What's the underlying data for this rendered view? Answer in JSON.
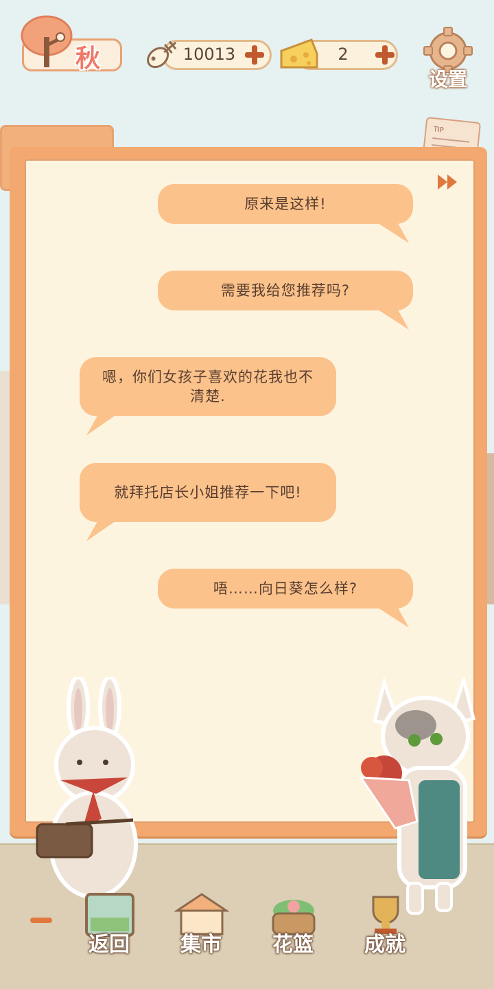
{
  "header": {
    "season": "秋",
    "fish_count": "10013",
    "cheese_count": "2",
    "settings_label": "设置"
  },
  "icons": [
    "tree-season-icon",
    "fish-bone-icon",
    "cheese-icon",
    "plus-icon",
    "gear-icon",
    "fast-forward-icon",
    "tip-note-icon"
  ],
  "dialog": {
    "messages": [
      {
        "speaker": "shopkeeper",
        "text": "原来是这样!"
      },
      {
        "speaker": "shopkeeper",
        "text": "需要我给您推荐吗?"
      },
      {
        "speaker": "customer",
        "text": "嗯，你们女孩子喜欢的花我也不清楚."
      },
      {
        "speaker": "customer",
        "text": "就拜托店长小姐推荐一下吧!"
      },
      {
        "speaker": "shopkeeper",
        "text": "唔……向日葵怎么样?"
      }
    ]
  },
  "nav": {
    "back": "返回",
    "market": "集市",
    "basket": "花篮",
    "achievements": "成就"
  },
  "colors": {
    "panel": "#f2a86e",
    "paper": "#fdf4e0",
    "bubble": "#fbc28c",
    "accent": "#e0783e"
  }
}
